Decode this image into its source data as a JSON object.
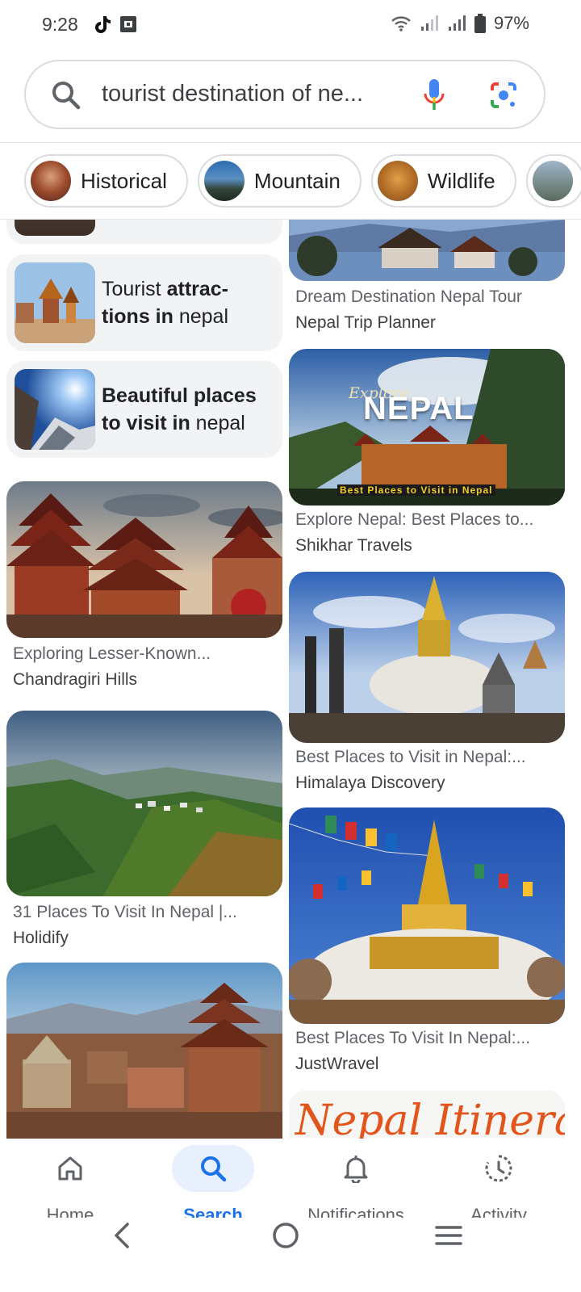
{
  "status": {
    "time": "9:28",
    "battery": "97%"
  },
  "search": {
    "query": "tourist destination of ne..."
  },
  "chips": [
    {
      "label": "Historical"
    },
    {
      "label": "Mountain"
    },
    {
      "label": "Wildlife"
    }
  ],
  "suggestions": [
    {
      "bold_a": "Tourist ",
      "bold_b": "attrac-",
      "bold_c": "tions in",
      "rest": " nepal"
    },
    {
      "bold": "Beautiful places to visit in",
      "rest": " nepal"
    }
  ],
  "results_left": [
    {
      "title": "Exploring Lesser-Known...",
      "source": "Chandragiri Hills"
    },
    {
      "title": "31 Places To Visit In Nepal |...",
      "source": "Holidify"
    }
  ],
  "results_right": [
    {
      "title": "Dream Destination Nepal Tour",
      "source": "Nepal Trip Planner"
    },
    {
      "title": "Explore Nepal: Best Places to...",
      "source": "Shikhar Travels",
      "overlay_title": "NEPAL",
      "overlay_script": "Explore",
      "overlay_caption": "Best Places to Visit in Nepal"
    },
    {
      "title": "Best Places to Visit in Nepal:...",
      "source": "Himalaya Discovery"
    },
    {
      "title": "Best Places To Visit In Nepal:...",
      "source": "JustWravel"
    },
    {
      "overlay_text": "Nepal Itinerary"
    }
  ],
  "bottom_nav": [
    {
      "label": "Home"
    },
    {
      "label": "Search"
    },
    {
      "label": "Notifications"
    },
    {
      "label": "Activity"
    }
  ],
  "colors": {
    "accent": "#1a73e8",
    "chip_border": "#dadce0",
    "suggestion_bg": "#f1f3f4"
  }
}
